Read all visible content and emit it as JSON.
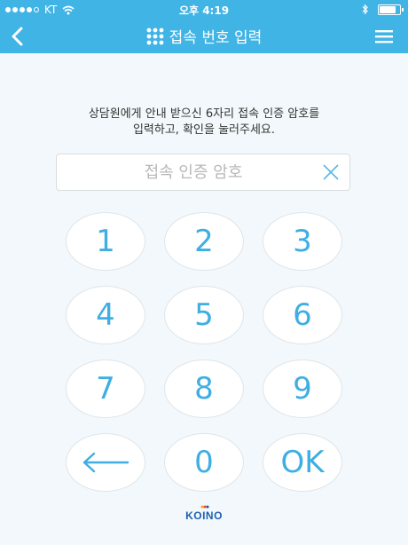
{
  "status_bar": {
    "carrier": "KT",
    "time": "오후 4:19",
    "icons": [
      "signal-dots-icon",
      "wifi-icon",
      "bluetooth-icon",
      "battery-icon"
    ],
    "battery_level": 0.9
  },
  "header": {
    "title": "접속 번호 입력",
    "back_icon": "chevron-left-icon",
    "menu_icon": "hamburger-menu-icon",
    "title_icon": "grid-dots-icon"
  },
  "instruction": {
    "line1": "상담원에게 안내 받으신 6자리 접속 인증 암호를",
    "line2": "입력하고, 확인을 눌러주세요."
  },
  "code_input": {
    "placeholder": "접속 인증 암호",
    "value": "",
    "clear_icon": "close-x-icon"
  },
  "keypad": {
    "keys": [
      "1",
      "2",
      "3",
      "4",
      "5",
      "6",
      "7",
      "8",
      "9",
      "",
      "0",
      "OK"
    ],
    "backspace_icon": "left-arrow-icon"
  },
  "footer": {
    "logo_text": "KOINO"
  },
  "colors": {
    "accent": "#41b4e6",
    "key_text": "#3eaee3",
    "background": "#f2f8fb",
    "logo": "#1f5fae"
  }
}
